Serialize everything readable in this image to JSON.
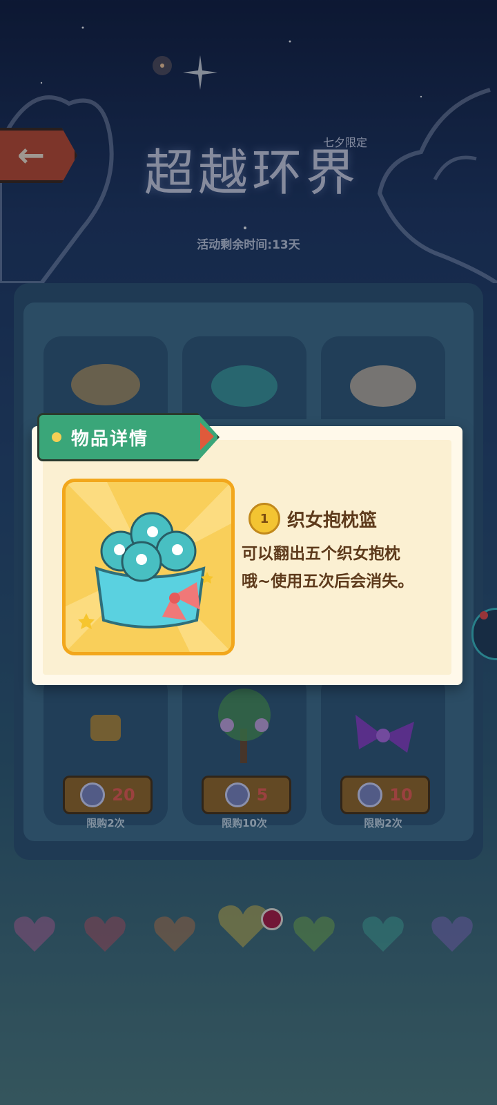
{
  "header": {
    "back_icon": "back-arrow-icon",
    "title": "超越环界",
    "title_tag": "七夕限定",
    "countdown": "活动剩余时间:13天"
  },
  "shop": {
    "items": [
      {
        "price": "20",
        "limit": "限购2次",
        "icon": "cheese-block-icon"
      },
      {
        "price": "5",
        "limit": "限购10次",
        "icon": "wisteria-tree-icon"
      },
      {
        "price": "10",
        "limit": "限购2次",
        "icon": "purple-bow-icon"
      }
    ],
    "currency_icon": "coin-icon"
  },
  "modal": {
    "tab_label": "物品详情",
    "item_name": "织女抱枕篮",
    "level": "1",
    "description_line1": "可以翻出五个织女抱枕",
    "description_line2": "哦~使用五次后会消失。"
  },
  "hearts": [
    "pink",
    "red",
    "orange",
    "yellow",
    "green",
    "teal",
    "purple"
  ],
  "colors": {
    "accent_green": "#3aa679",
    "accent_red": "#c44a2d",
    "text_brown": "#5d3a1b",
    "price_red": "#f25d4e"
  }
}
